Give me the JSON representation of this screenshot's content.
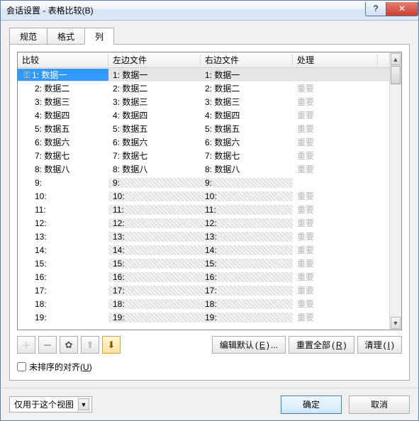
{
  "title": "会话设置 - 表格比较(B)",
  "tabs": [
    "规范",
    "格式",
    "列"
  ],
  "active_tab": 2,
  "columns": [
    "比较",
    "左边文件",
    "右边文件",
    "处理"
  ],
  "rows": [
    {
      "idx": "1",
      "label": "数据一",
      "status": "",
      "sel": true
    },
    {
      "idx": "2",
      "label": "数据二",
      "status": "重要"
    },
    {
      "idx": "3",
      "label": "数据三",
      "status": "重要"
    },
    {
      "idx": "4",
      "label": "数据四",
      "status": "重要"
    },
    {
      "idx": "5",
      "label": "数据五",
      "status": "重要"
    },
    {
      "idx": "6",
      "label": "数据六",
      "status": "重要"
    },
    {
      "idx": "7",
      "label": "数据七",
      "status": "重要"
    },
    {
      "idx": "8",
      "label": "数据八",
      "status": "重要"
    },
    {
      "idx": "9",
      "label": "",
      "status": ""
    },
    {
      "idx": "10",
      "label": "",
      "status": "重要"
    },
    {
      "idx": "11",
      "label": "",
      "status": "重要"
    },
    {
      "idx": "12",
      "label": "",
      "status": "重要"
    },
    {
      "idx": "13",
      "label": "",
      "status": "重要"
    },
    {
      "idx": "14",
      "label": "",
      "status": "重要"
    },
    {
      "idx": "15",
      "label": "",
      "status": "重要"
    },
    {
      "idx": "16",
      "label": "",
      "status": "重要"
    },
    {
      "idx": "17",
      "label": "",
      "status": "重要"
    },
    {
      "idx": "18",
      "label": "",
      "status": "重要"
    },
    {
      "idx": "19",
      "label": "",
      "status": "重要"
    }
  ],
  "toolbar": {
    "plus": "＋",
    "minus": "－",
    "gear": "✿",
    "up": "⬆",
    "down": "⬇"
  },
  "buttons": {
    "edit_default": "编辑默认",
    "edit_default_key": "E",
    "edit_default_suffix": "...",
    "reset_all": "重置全部",
    "reset_all_key": "R",
    "clear": "清理",
    "clear_key": "I"
  },
  "checkbox_label": "未排序的对齐",
  "checkbox_key": "U",
  "combo_value": "仅用于这个视图",
  "ok": "确定",
  "cancel": "取消",
  "help": "?",
  "close": "✕"
}
